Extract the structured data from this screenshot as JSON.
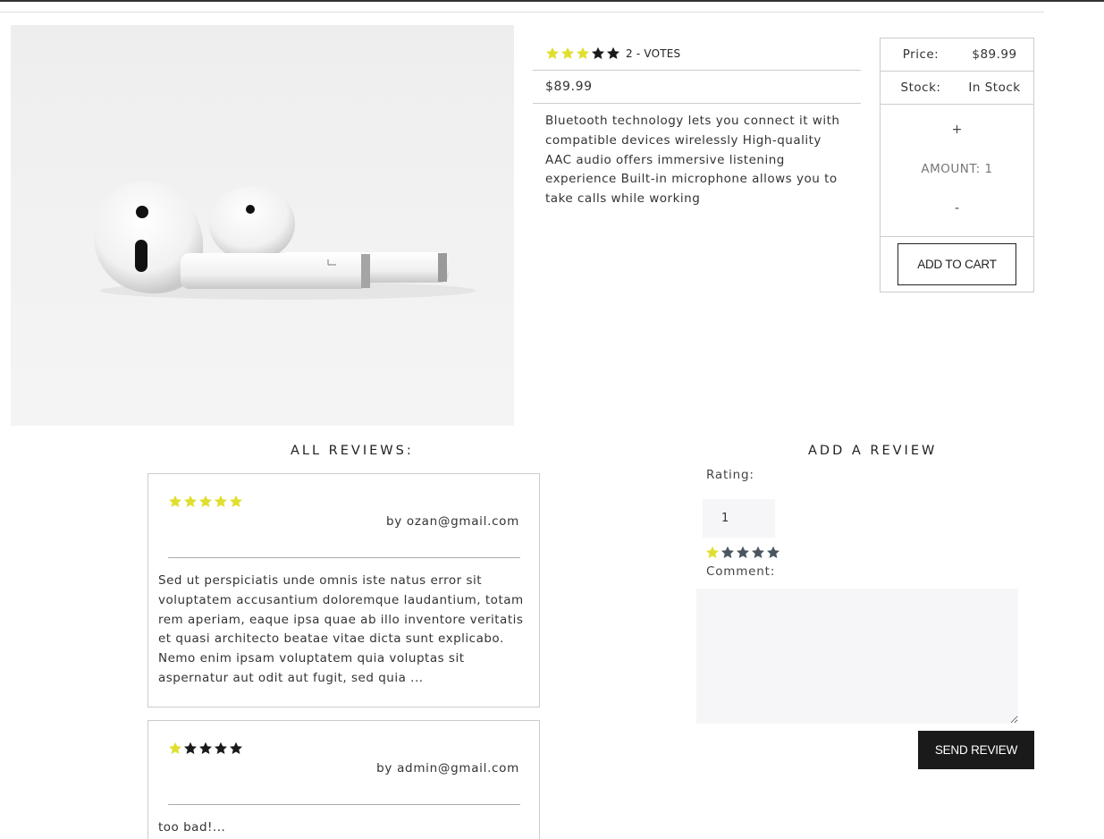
{
  "product": {
    "image_alt": "AirPods",
    "rating_stars": [
      true,
      true,
      true,
      false,
      false
    ],
    "votes_label": "2 - VOTES",
    "price": "$89.99",
    "description": "Bluetooth technology lets you connect it with compatible devices wirelessly High-quality AAC audio offers immersive listening experience Built-in microphone allows you to take calls while working"
  },
  "purchase": {
    "price_label": "Price:",
    "price_value": "$89.99",
    "stock_label": "Stock:",
    "stock_value": "In Stock",
    "plus": "+",
    "amount_label": "AMOUNT: 1",
    "minus": "-",
    "add_to_cart": "ADD TO CART"
  },
  "reviews": {
    "title": "ALL REVIEWS:",
    "items": [
      {
        "rating": 5,
        "author": "by ozan@gmail.com",
        "body": "Sed ut perspiciatis unde omnis iste natus error sit voluptatem accusantium doloremque laudantium, totam rem aperiam, eaque ipsa quae ab illo inventore veritatis et quasi architecto beatae vitae dicta sunt explicabo. Nemo enim ipsam voluptatem quia voluptas sit aspernatur aut odit aut fugit, sed quia ..."
      },
      {
        "rating": 1,
        "author": "by admin@gmail.com",
        "body": "too bad!..."
      }
    ]
  },
  "review_form": {
    "title": "ADD A REVIEW",
    "rating_label": "Rating:",
    "rating_value": "1",
    "comment_label": "Comment:",
    "comment_value": "",
    "send_label": "SEND REVIEW",
    "selected_rating": 1
  },
  "colors": {
    "star_filled": "#e0df2f",
    "star_empty_dark": "#1a1a1a",
    "star_empty_form": "#4a5560",
    "button_dark": "#1a1a1a"
  }
}
